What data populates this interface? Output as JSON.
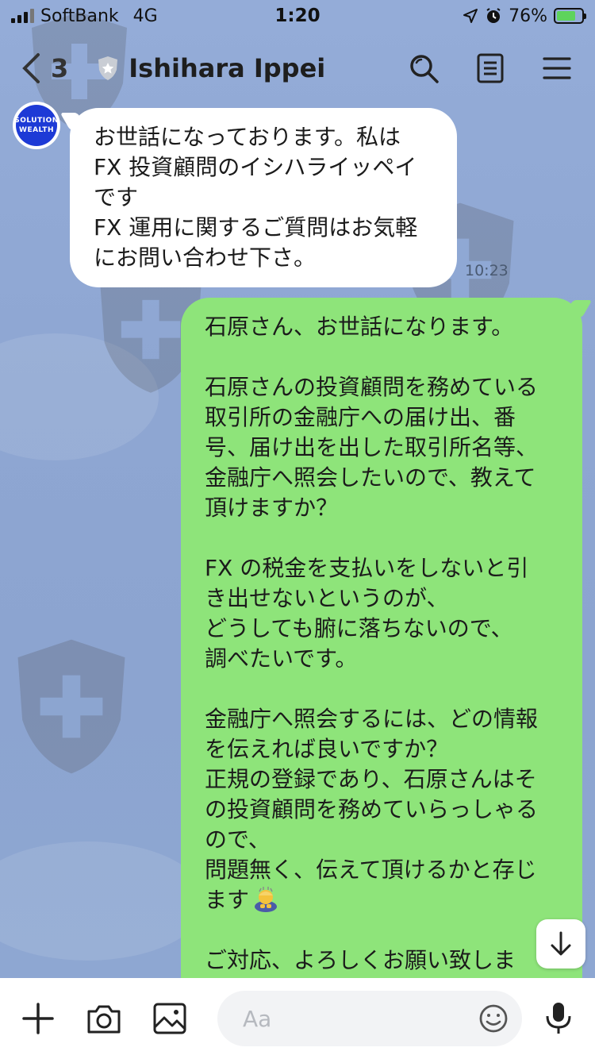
{
  "status_bar": {
    "carrier": "SoftBank",
    "network": "4G",
    "time": "1:20",
    "battery_percent": "76%",
    "battery_level": 0.76
  },
  "header": {
    "back_count": "3",
    "title": "Ishihara Ippei",
    "icons": [
      "search-icon",
      "note-icon",
      "menu-icon"
    ]
  },
  "avatar": {
    "line1": "SOLUTION",
    "line2": "WEALTH"
  },
  "incoming_message": {
    "lines": [
      "お世話になっております。私は",
      "FX 投資顧問のイシハライッペイ",
      "です",
      "FX 運用に関するご質問はお気軽",
      "にお問い合わせ下さ。"
    ],
    "time": "10:23"
  },
  "outgoing_message": {
    "lines": [
      "石原さん、お世話になります。",
      "",
      "石原さんの投資顧問を務めている",
      "取引所の金融庁への届け出、番",
      "号、届け出を出した取引所名等、",
      "金融庁へ照会したいので、教えて",
      "頂けますか？",
      "",
      "FX の税金を支払いをしないと引",
      "き出せないというのが、",
      "どうしても腑に落ちないので、",
      "調べたいです。",
      "",
      "金融庁へ照会するには、どの情報",
      "を伝えれば良いですか？",
      "正規の登録であり、石原さんはそ",
      "の投資顧問を務めていらっしゃる",
      "ので、",
      "問題無く、伝えて頂けるかと存じ",
      "ます",
      "",
      "ご対応、よろしくお願い致しま"
    ],
    "emoji": "bowing-person-emoji",
    "color": "#8ee47a"
  },
  "input_bar": {
    "placeholder": "Aa",
    "icons": [
      "plus-icon",
      "camera-icon",
      "image-icon",
      "emoji-icon",
      "mic-icon"
    ]
  }
}
